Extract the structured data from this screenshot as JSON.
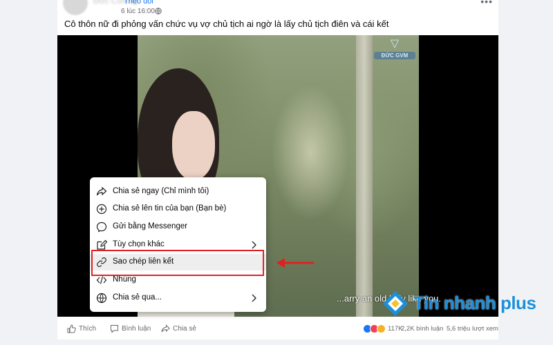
{
  "post": {
    "author": "Đức Cường",
    "follow_label": "Theo dõi",
    "timestamp": "6 lúc 16:00",
    "title": "Cô thôn nữ đi phỏng vấn chức vụ vợ chủ tịch ai ngờ là lấy chủ tịch điên và cái kết"
  },
  "video": {
    "channel_logo": "ĐỨC GVM",
    "subtitle": "...arry an old lady like you."
  },
  "share_menu": {
    "items": [
      {
        "label": "Chia sẻ ngay (Chỉ mình tôi)",
        "icon": "share-arrow-icon"
      },
      {
        "label": "Chia sẻ lên tin của bạn (Bạn bè)",
        "icon": "add-story-icon"
      },
      {
        "label": "Gửi bằng Messenger",
        "icon": "messenger-icon"
      },
      {
        "label": "Tùy chọn khác",
        "icon": "edit-icon",
        "has_submenu": true
      },
      {
        "label": "Sao chép liên kết",
        "icon": "link-icon",
        "highlighted": true
      },
      {
        "label": "Nhúng",
        "icon": "code-icon"
      },
      {
        "label": "Chia sẻ qua...",
        "icon": "globe-icon",
        "has_submenu": true
      }
    ]
  },
  "actions": {
    "like": "Thích",
    "comment": "Bình luận",
    "share": "Chia sẻ"
  },
  "stats": {
    "reactions": "117K",
    "comments": "2,2K bình luận",
    "views": "5,6 triệu lượt xem"
  },
  "watermark": {
    "text": "Tin nhanh plus"
  },
  "colors": {
    "accent": "#1877f2",
    "highlight_border": "#e02020",
    "watermark": "#1c8fdb"
  }
}
